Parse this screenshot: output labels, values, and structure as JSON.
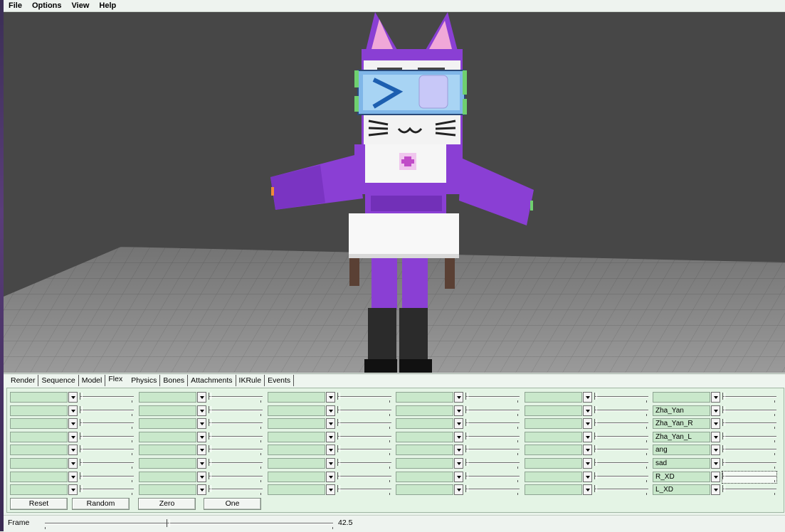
{
  "menu": [
    "File",
    "Options",
    "View",
    "Help"
  ],
  "tabs": [
    "Render",
    "Sequence",
    "Model",
    "Flex",
    "Physics",
    "Bones",
    "Attachments",
    "IKRule",
    "Events"
  ],
  "active_tab": "Flex",
  "flex_columns": [
    {
      "controllers": [
        "",
        "",
        "",
        "",
        "",
        "",
        "",
        ""
      ]
    },
    {
      "controllers": [
        "",
        "",
        "",
        "",
        "",
        "",
        "",
        ""
      ]
    },
    {
      "controllers": [
        "",
        "",
        "",
        "",
        "",
        "",
        "",
        ""
      ]
    },
    {
      "controllers": [
        "",
        "",
        "",
        "",
        "",
        "",
        "",
        ""
      ]
    },
    {
      "controllers": [
        "",
        "",
        "",
        "",
        "",
        "",
        "",
        ""
      ]
    },
    {
      "controllers": [
        "",
        "Zha_Yan",
        "Zha_Yan_R",
        "Zha_Yan_L",
        "ang",
        "sad",
        "R_XD",
        "L_XD"
      ]
    }
  ],
  "buttons": {
    "reset": "Reset",
    "random": "Random",
    "zero": "Zero",
    "one": "One"
  },
  "frame": {
    "label": "Frame",
    "value": "42.5"
  },
  "colors": {
    "viewport_bg": "#474747",
    "panel_bg": "#e4f4e5",
    "select_bg": "#c9e8cb",
    "character_purple": "#8a3fd4"
  }
}
